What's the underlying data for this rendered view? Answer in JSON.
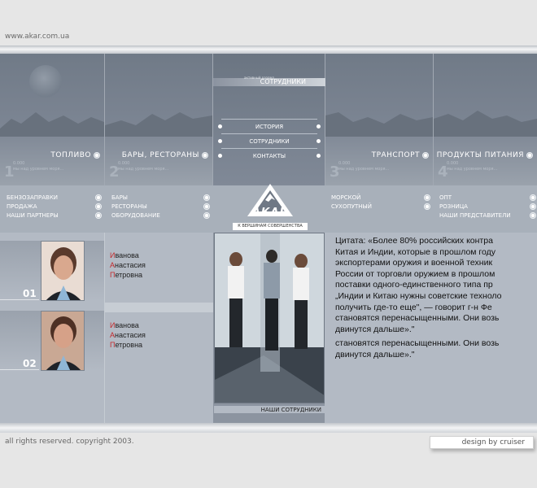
{
  "site": {
    "url": "www.akar.com.ua"
  },
  "top_panels": [
    {
      "title": "топливо",
      "num": "1",
      "sub1": "0.000",
      "sub2": "мы над уровнем моря..."
    },
    {
      "title": "бары, рестораны",
      "num": "2",
      "sub1": "0.000",
      "sub2": "мы над уровнем моря..."
    },
    {
      "title": "транспорт",
      "num": "3",
      "sub1": "0.000",
      "sub2": "мы над уровнем моря..."
    },
    {
      "title": "продукты питания",
      "num": "4",
      "sub1": "0.000",
      "sub2": "мы над уровнем моря..."
    }
  ],
  "center_menu": {
    "header": "сотрудники",
    "header_small": "активный раздел",
    "items": [
      "история",
      "сотрудники",
      "контакты"
    ]
  },
  "sub_links": {
    "col1": [
      "бензозаправки",
      "продажа",
      "наши партнеры"
    ],
    "col2": [
      "бары",
      "рестораны",
      "оборудование"
    ],
    "col3": [
      "морской",
      "сухопутный"
    ],
    "col4": [
      "опт",
      "розница",
      "наши представители"
    ]
  },
  "logo": {
    "name": "АКАР",
    "tagline": "к вершинам совершенства"
  },
  "staff": [
    {
      "num": "01",
      "line1": "Иванова",
      "line2": "Анастасия",
      "line3": "Петровна"
    },
    {
      "num": "02",
      "line1": "Иванова",
      "line2": "Анастасия",
      "line3": "Петровна"
    }
  ],
  "photo_caption": "наши сотрудники",
  "quote": {
    "lines": [
      "Цитата: «Более 80% российских контра",
      "Китая и Индии, которые в прошлом году",
      "экспортерами оружия и военной техник",
      "России от торговли оружием в прошлом",
      "поставки одного-единственного типа пр",
      "„Индии и Китаю нужны советские техноло",
      "получить где-то еще\", — говорит г-н Фе",
      "становятся перенасыщенными. Они возь",
      "двинутся дальше».\""
    ],
    "lines2": [
      "становятся перенасыщенными. Они возь",
      "двинутся дальше».\""
    ]
  },
  "footer": {
    "copyright": "all rights reserved. copyright 2003.",
    "design": "design by cruiser"
  },
  "colors": {
    "accent_red": "#c0292b",
    "panel_gray": "#7c8593"
  }
}
